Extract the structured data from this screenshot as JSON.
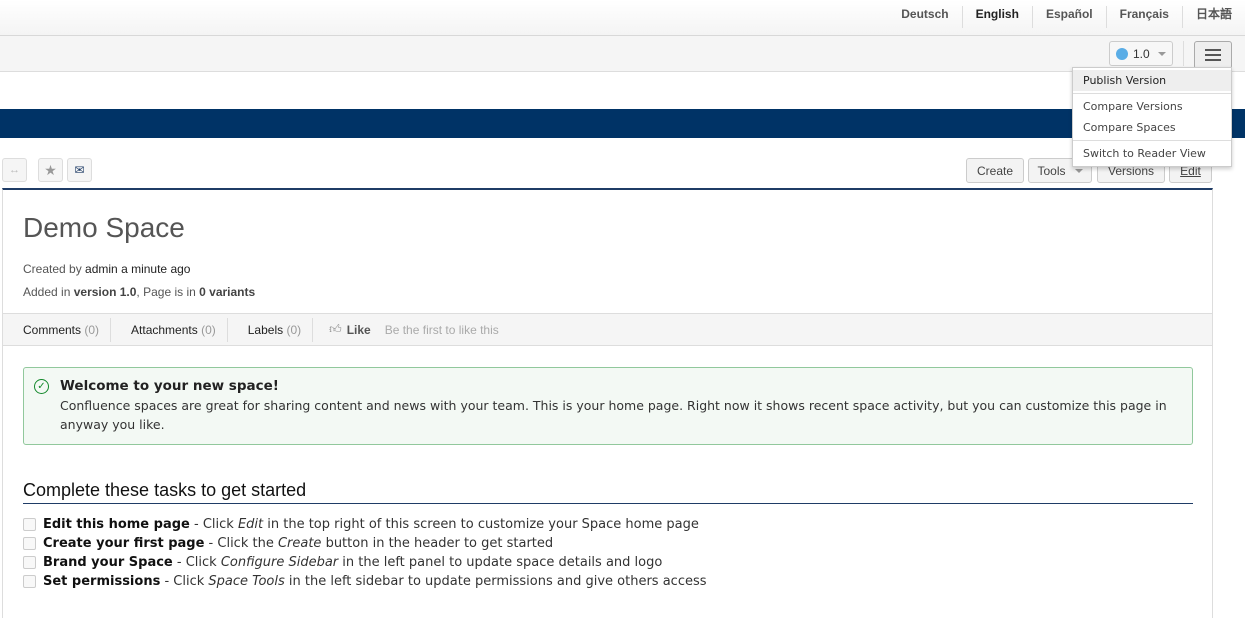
{
  "languages": [
    {
      "label": "Deutsch",
      "active": false
    },
    {
      "label": "English",
      "active": true
    },
    {
      "label": "Español",
      "active": false
    },
    {
      "label": "Français",
      "active": false
    },
    {
      "label": "日本語",
      "active": false
    }
  ],
  "toolbar": {
    "version": "1.0",
    "version_dot_color": "#5aade6",
    "menu_icon": "hamburger-icon"
  },
  "menu": {
    "items": [
      "Publish Version",
      "Compare Versions",
      "Compare Spaces",
      "Switch to Reader View"
    ]
  },
  "brand_color": "#003366",
  "page_actions": {
    "create": "Create",
    "tools": "Tools",
    "versions": "Versions",
    "edit": "Edit"
  },
  "icon_buttons": [
    "expand-icon",
    "star-icon",
    "watch-icon"
  ],
  "page": {
    "title": "Demo Space",
    "created_prefix": "Created by",
    "created_user": "admin",
    "created_time": "a minute ago",
    "added_prefix": "Added in",
    "added_version": "version 1.0",
    "added_mid": ", Page is in",
    "added_variants": "0 variants",
    "tabs": [
      {
        "label": "Comments",
        "count": "(0)"
      },
      {
        "label": "Attachments",
        "count": "(0)"
      },
      {
        "label": "Labels",
        "count": "(0)"
      }
    ],
    "like": "Like",
    "like_msg": "Be the first to like this"
  },
  "welcome": {
    "title": "Welcome to your new space!",
    "body": "Confluence spaces are great for sharing content and news with your team. This is your home page. Right now it shows recent space activity, but you can customize this page in anyway you like."
  },
  "tasks_heading": "Complete these tasks to get started",
  "tasks": [
    {
      "bold": "Edit this home page",
      "a": " - Click ",
      "em": "Edit",
      "b": " in the top right of this screen to customize your Space home page"
    },
    {
      "bold": "Create your first page",
      "a": " - Click the ",
      "em": "Create",
      "b": " button in the header to get started"
    },
    {
      "bold": "Brand your Space",
      "a": " - Click ",
      "em": "Configure Sidebar",
      "b": " in the left panel to update space details and logo"
    },
    {
      "bold": "Set permissions",
      "a": " - Click ",
      "em": "Space Tools",
      "b": " in the left sidebar to update permissions and give others access"
    }
  ]
}
